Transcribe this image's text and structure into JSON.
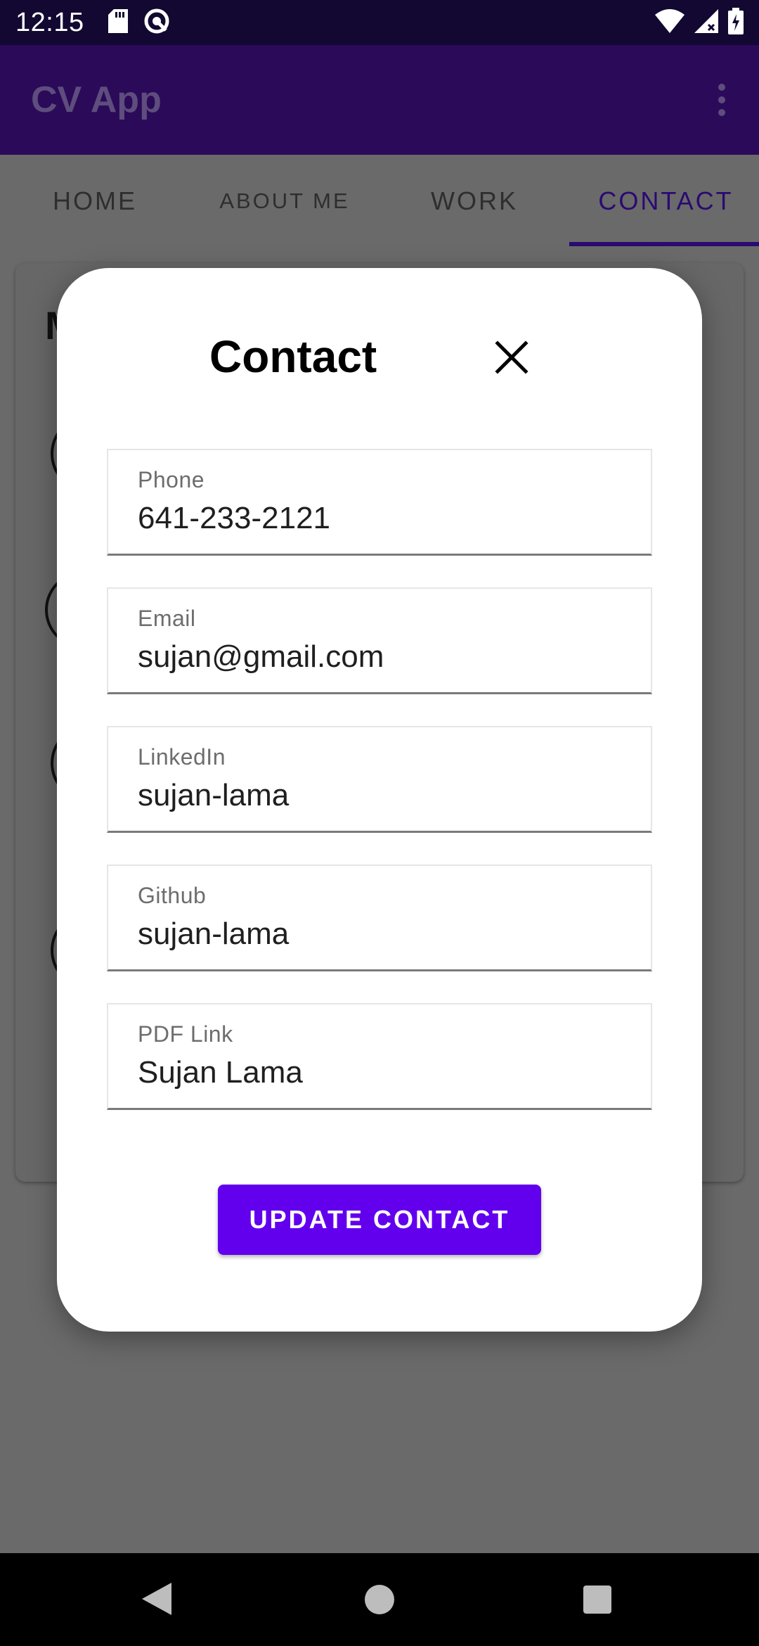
{
  "status_bar": {
    "time": "12:15",
    "left_icons": [
      "sd-card-icon",
      "data-saver-icon"
    ],
    "right_icons": [
      "wifi-icon",
      "signal-icon",
      "battery-icon"
    ]
  },
  "app_bar": {
    "title": "CV App",
    "menu_icon": "more-vert-icon"
  },
  "tabs": [
    {
      "label": "HOME",
      "active": false
    },
    {
      "label": "ABOUT ME",
      "active": false
    },
    {
      "label": "WORK",
      "active": false
    },
    {
      "label": "CONTACT",
      "active": true
    }
  ],
  "background_card": {
    "visible_initial": "M"
  },
  "dialog": {
    "title": "Contact",
    "close_icon": "close-icon",
    "fields": [
      {
        "label": "Phone",
        "value": "641-233-2121"
      },
      {
        "label": "Email",
        "value": "sujan@gmail.com"
      },
      {
        "label": "LinkedIn",
        "value": "sujan-lama"
      },
      {
        "label": "Github",
        "value": "sujan-lama"
      },
      {
        "label": "PDF Link",
        "value": "Sujan Lama"
      }
    ],
    "submit_label": "UPDATE CONTACT"
  },
  "colors": {
    "primary": "#6200ee",
    "app_bar": "#2b0a5a",
    "status_bar": "#120831",
    "scrim": "#6a6a6a"
  },
  "nav_bar": {
    "buttons": [
      "back-icon",
      "home-icon",
      "recents-icon"
    ]
  }
}
